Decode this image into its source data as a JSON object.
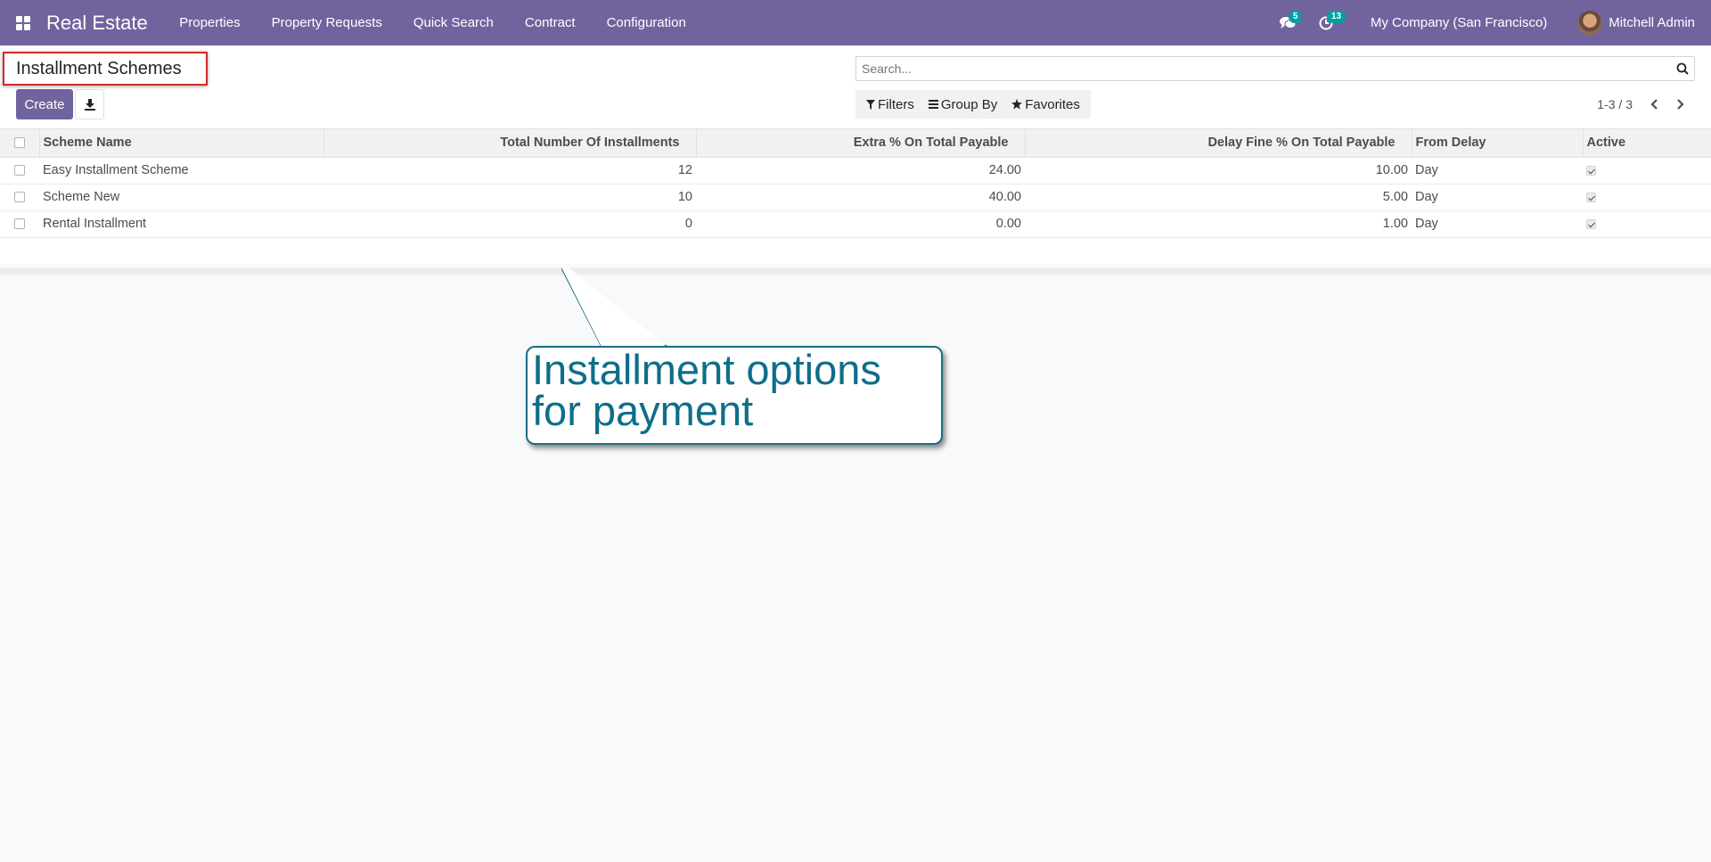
{
  "navbar": {
    "brand": "Real Estate",
    "menu": [
      "Properties",
      "Property Requests",
      "Quick Search",
      "Contract",
      "Configuration"
    ],
    "messages_count": "5",
    "activities_count": "13",
    "company": "My Company (San Francisco)",
    "user": "Mitchell Admin"
  },
  "control_panel": {
    "title": "Installment Schemes",
    "create_label": "Create",
    "search_placeholder": "Search...",
    "filters_label": "Filters",
    "group_by_label": "Group By",
    "favorites_label": "Favorites",
    "pager": "1-3 / 3"
  },
  "table": {
    "headers": [
      "Scheme Name",
      "Total Number Of Installments",
      "Extra % On Total Payable",
      "Delay Fine % On Total Payable",
      "From Delay",
      "Active"
    ],
    "rows": [
      {
        "name": "Easy Installment Scheme",
        "installments": "12",
        "extra": "24.00",
        "delay_fine": "10.00",
        "from_delay": "Day",
        "active": true
      },
      {
        "name": "Scheme New",
        "installments": "10",
        "extra": "40.00",
        "delay_fine": "5.00",
        "from_delay": "Day",
        "active": true
      },
      {
        "name": "Rental Installment",
        "installments": "0",
        "extra": "0.00",
        "delay_fine": "1.00",
        "from_delay": "Day",
        "active": true
      }
    ]
  },
  "callout": {
    "text": "Installment options for payment"
  },
  "colors": {
    "navbar": "#71639e",
    "badge": "#00a09d",
    "title_highlight": "#d02a2a",
    "callout_text": "#0e6e8a"
  }
}
